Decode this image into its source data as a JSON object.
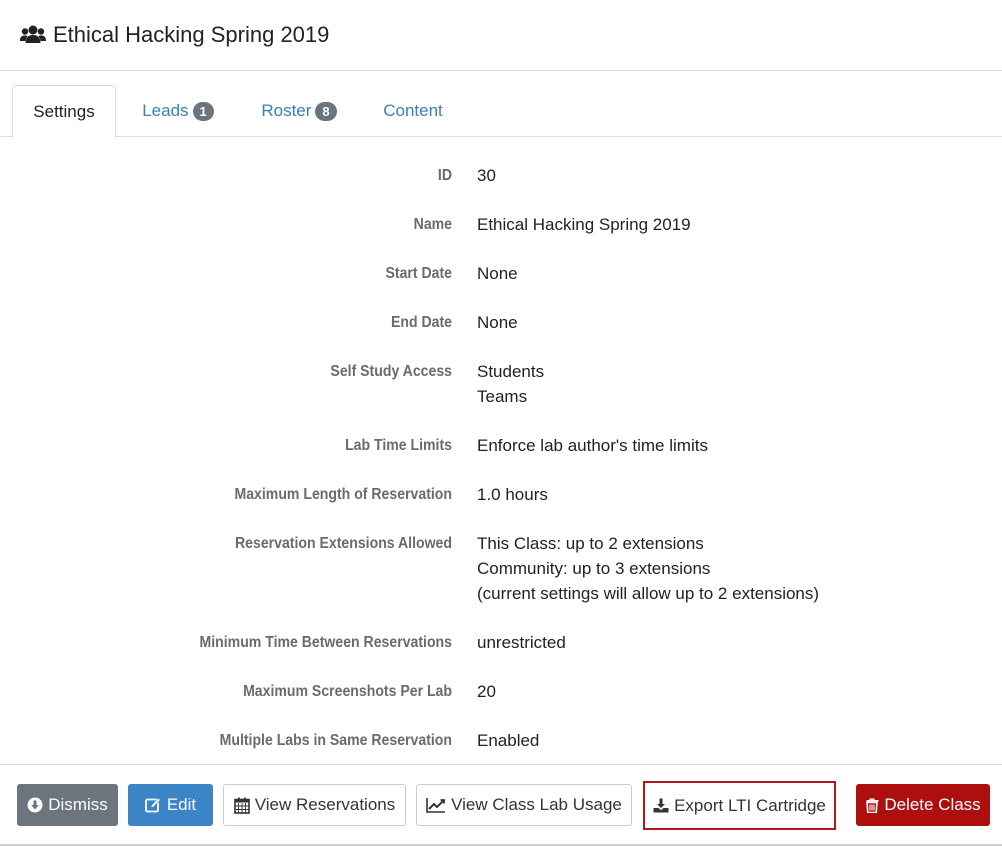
{
  "page": {
    "title": "Ethical Hacking Spring 2019"
  },
  "tabs": [
    {
      "label": "Settings"
    },
    {
      "label": "Leads",
      "badge": "1"
    },
    {
      "label": "Roster",
      "badge": "8"
    },
    {
      "label": "Content"
    }
  ],
  "details": [
    {
      "label": "ID",
      "values": [
        "30"
      ]
    },
    {
      "label": "Name",
      "values": [
        "Ethical Hacking Spring 2019"
      ]
    },
    {
      "label": "Start Date",
      "values": [
        "None"
      ]
    },
    {
      "label": "End Date",
      "values": [
        "None"
      ]
    },
    {
      "label": "Self Study Access",
      "values": [
        "Students",
        "Teams"
      ]
    },
    {
      "label": "Lab Time Limits",
      "values": [
        "Enforce lab author's time limits"
      ]
    },
    {
      "label": "Maximum Length of Reservation",
      "values": [
        "1.0 hours"
      ]
    },
    {
      "label": "Reservation Extensions Allowed",
      "values": [
        "This Class: up to 2 extensions",
        "Community: up to 3 extensions",
        "(current settings will allow up to 2 extensions)"
      ]
    },
    {
      "label": "Minimum Time Between Reservations",
      "values": [
        "unrestricted"
      ]
    },
    {
      "label": "Maximum Screenshots Per Lab",
      "values": [
        "20"
      ]
    },
    {
      "label": "Multiple Labs in Same Reservation",
      "values": [
        "Enabled"
      ]
    }
  ],
  "buttons": {
    "dismiss": "Dismiss",
    "edit": "Edit",
    "view_reservations": "View Reservations",
    "view_class_lab_usage": "View Class Lab Usage",
    "export_lti": "Export LTI Cartridge",
    "delete_class": "Delete Class"
  },
  "icons": {
    "header": "users-icon",
    "dismiss": "arrow-circle-down-icon",
    "edit": "edit-icon",
    "view_reservations": "calendar-icon",
    "usage": "line-chart-icon",
    "export": "download-icon",
    "delete": "trash-icon"
  },
  "colors": {
    "link": "#3b7fb7",
    "primary": "#3b85c6",
    "secondary": "#6c757d",
    "danger": "#ad0e0e",
    "highlight": "#b4161b"
  }
}
